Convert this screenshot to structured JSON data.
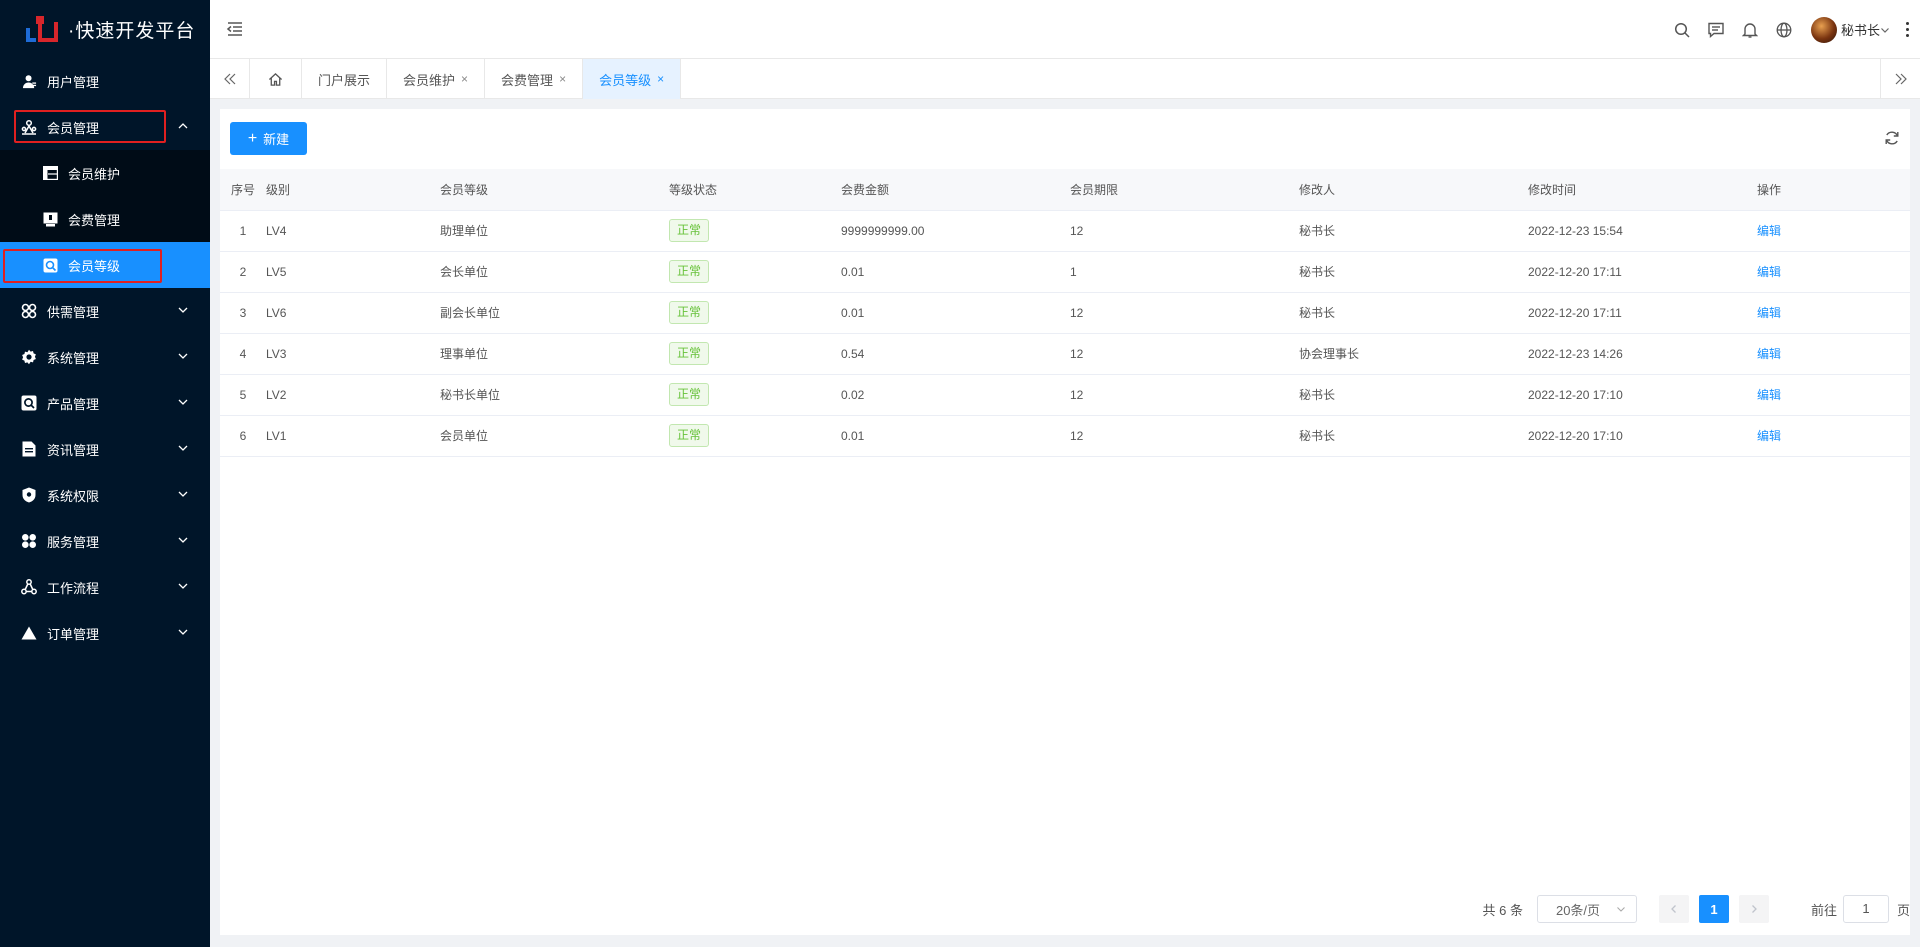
{
  "app": {
    "title": "·快速开发平台"
  },
  "sidebar": {
    "items": [
      {
        "label": "用户管理"
      },
      {
        "label": "会员管理"
      },
      {
        "label": "供需管理"
      },
      {
        "label": "系统管理"
      },
      {
        "label": "产品管理"
      },
      {
        "label": "资讯管理"
      },
      {
        "label": "系统权限"
      },
      {
        "label": "服务管理"
      },
      {
        "label": "工作流程"
      },
      {
        "label": "订单管理"
      }
    ],
    "submenu": [
      {
        "label": "会员维护"
      },
      {
        "label": "会费管理"
      },
      {
        "label": "会员等级"
      }
    ]
  },
  "header": {
    "user_name": "秘书长"
  },
  "tabs": [
    {
      "label": "门户展示"
    },
    {
      "label": "会员维护",
      "close": "×"
    },
    {
      "label": "会费管理",
      "close": "×"
    },
    {
      "label": "会员等级",
      "close": "×"
    }
  ],
  "toolbar": {
    "new_label": "新建"
  },
  "table": {
    "headers": [
      "序号",
      "级别",
      "会员等级",
      "等级状态",
      "会费金额",
      "会员期限",
      "修改人",
      "修改时间",
      "操作"
    ],
    "rows": [
      [
        "1",
        "LV4",
        "助理单位",
        "正常",
        "9999999999.00",
        "12",
        "秘书长",
        "2022-12-23 15:54",
        "编辑"
      ],
      [
        "2",
        "LV5",
        "会长单位",
        "正常",
        "0.01",
        "1",
        "秘书长",
        "2022-12-20 17:11",
        "编辑"
      ],
      [
        "3",
        "LV6",
        "副会长单位",
        "正常",
        "0.01",
        "12",
        "秘书长",
        "2022-12-20 17:11",
        "编辑"
      ],
      [
        "4",
        "LV3",
        "理事单位",
        "正常",
        "0.54",
        "12",
        "协会理事长",
        "2022-12-23 14:26",
        "编辑"
      ],
      [
        "5",
        "LV2",
        "秘书长单位",
        "正常",
        "0.02",
        "12",
        "秘书长",
        "2022-12-20 17:10",
        "编辑"
      ],
      [
        "6",
        "LV1",
        "会员单位",
        "正常",
        "0.01",
        "12",
        "秘书长",
        "2022-12-20 17:10",
        "编辑"
      ]
    ]
  },
  "pagination": {
    "total": "共 6 条",
    "page_size": "20条/页",
    "current": "1",
    "goto_label": "前往",
    "goto_value": "1",
    "page_suffix": "页"
  },
  "colors": {
    "sidebar_bg": "#001529",
    "accent": "#1890ff",
    "highlight_box": "#e02020",
    "status_green": "#67c23a"
  }
}
